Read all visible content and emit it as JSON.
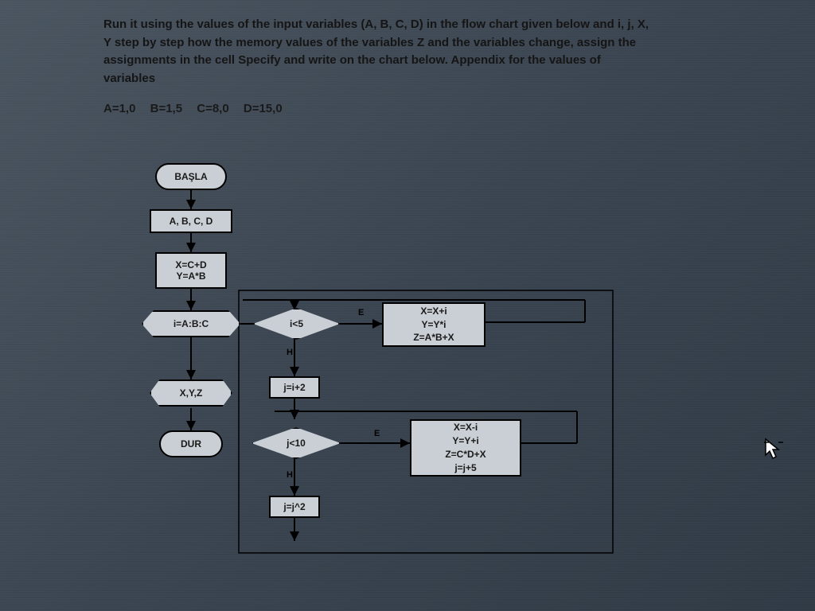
{
  "instructions": {
    "line1": "Run it using the values of the input variables (A, B, C, D) in the flow chart given below and i, j, X,",
    "line2": "Y step by step how the memory values of the variables Z and the variables change, assign the",
    "line3": "assignments in the cell Specify and write on the chart below. Appendix for the values of",
    "line4": "variables"
  },
  "inputs": {
    "A": "A=1,0",
    "B": "B=1,5",
    "C": "C=8,0",
    "D": "D=15,0"
  },
  "nodes": {
    "start": "BAŞLA",
    "input": "A, B, C, D",
    "init1": "X=C+D",
    "init2": "Y=A*B",
    "loop_setup": "i=A:B:C",
    "output": "X,Y,Z",
    "stop": "DUR",
    "dec1": "i<5",
    "proc1_1": "X=X+i",
    "proc1_2": "Y=Y*i",
    "proc1_3": "Z=A*B+X",
    "jassign": "j=i+2",
    "dec2": "j<10",
    "proc2_1": "X=X-i",
    "proc2_2": "Y=Y+i",
    "proc2_3": "Z=C*D+X",
    "proc2_4": "j=j+5",
    "jupdate": "j=j^2"
  },
  "labels": {
    "E": "E",
    "H": "H"
  }
}
